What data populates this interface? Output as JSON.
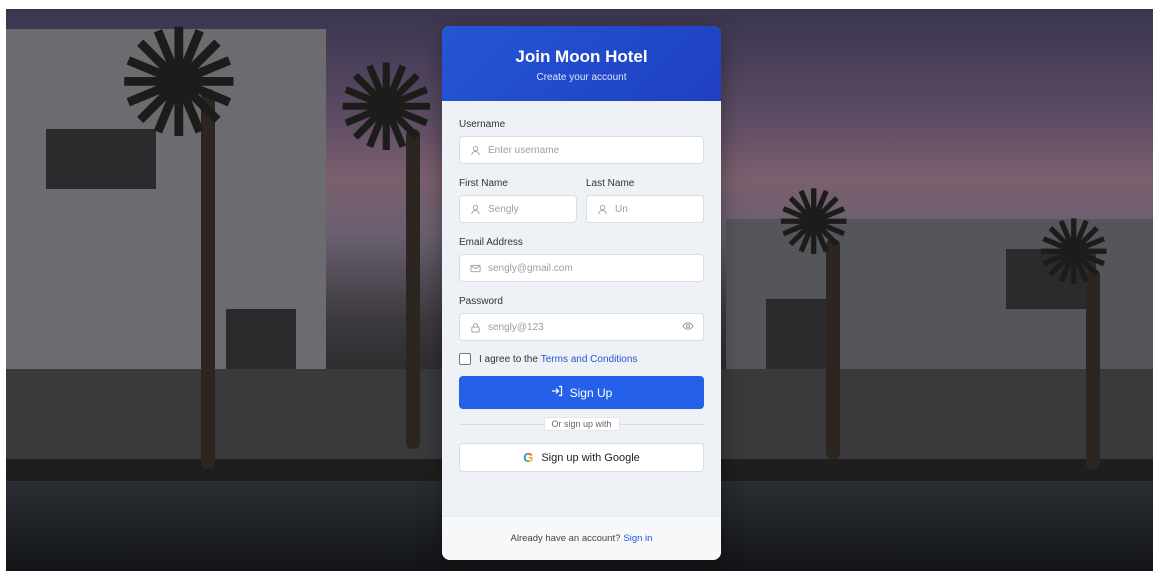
{
  "header": {
    "title": "Join Moon Hotel",
    "subtitle": "Create your account"
  },
  "form": {
    "username": {
      "label": "Username",
      "placeholder": "Enter username",
      "icon": "user-icon"
    },
    "first_name": {
      "label": "First Name",
      "placeholder": "Sengly",
      "icon": "user-icon"
    },
    "last_name": {
      "label": "Last Name",
      "placeholder": "Un",
      "icon": "user-icon"
    },
    "email": {
      "label": "Email Address",
      "placeholder": "sengly@gmail.com",
      "icon": "mail-icon"
    },
    "password": {
      "label": "Password",
      "placeholder": "sengly@123",
      "icon": "lock-icon",
      "toggle_icon": "eye-icon"
    },
    "terms": {
      "prefix": "I agree to the",
      "link": "Terms and Conditions"
    },
    "submit_label": "Sign Up",
    "divider": "Or sign up with",
    "google_label": "Sign up with Google"
  },
  "footer": {
    "text": "Already have an account?",
    "link": "Sign in"
  },
  "colors": {
    "accent": "#2461e8",
    "header_gradient_start": "#2456d6",
    "header_gradient_end": "#1f3fc2",
    "link": "#2457d6"
  }
}
